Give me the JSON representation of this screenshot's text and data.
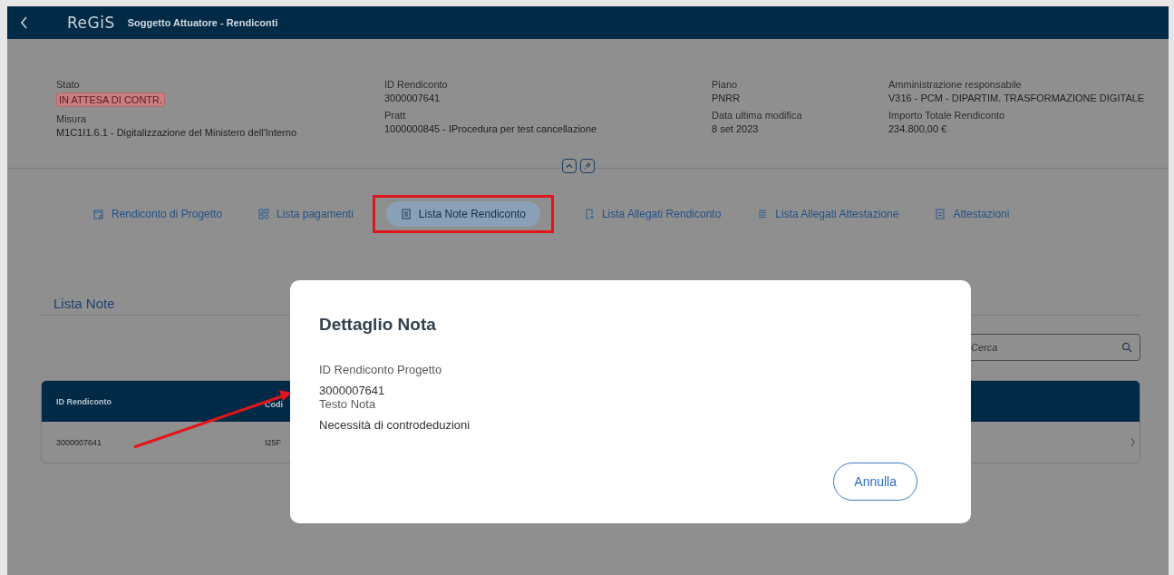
{
  "shell": {
    "logo": "ReGiS",
    "title": "Soggetto Attuatore - Rendiconti"
  },
  "info_columns": [
    {
      "fields": [
        {
          "label": "Stato",
          "value": "IN ATTESA DI CONTR.",
          "kind": "status"
        },
        {
          "label": "Misura",
          "value": "M1C1I1.6.1 - Digitalizzazione del Ministero dell'Interno",
          "kind": "text"
        }
      ]
    },
    {
      "fields": [
        {
          "label": "ID Rendiconto",
          "value": "3000007641",
          "kind": "text"
        },
        {
          "label": "Pratt",
          "value": "1000000845 - IProcedura per test cancellazione",
          "kind": "text"
        }
      ]
    },
    {
      "fields": [
        {
          "label": "Piano",
          "value": "PNRR",
          "kind": "text"
        },
        {
          "label": "Data ultima modifica",
          "value": "8 set 2023",
          "kind": "text"
        }
      ]
    },
    {
      "fields": [
        {
          "label": "Amministrazione responsabile",
          "value": "V316 - PCM - DIPARTIM. TRASFORMAZIONE DIGITALE",
          "kind": "text"
        },
        {
          "label": "Importo Totale Rendiconto",
          "value": "234.800,00 €",
          "kind": "text"
        }
      ]
    }
  ],
  "tabs": [
    {
      "label": "Rendiconto di Progetto",
      "selected": false,
      "outlined": false
    },
    {
      "label": "Lista pagamenti",
      "selected": false,
      "outlined": false
    },
    {
      "label": "Lista Note Rendiconto",
      "selected": true,
      "outlined": true
    },
    {
      "label": "Lista Allegati Rendiconto",
      "selected": false,
      "outlined": false
    },
    {
      "label": "Lista Allegati Attestazione",
      "selected": false,
      "outlined": false
    },
    {
      "label": "Attestazioni",
      "selected": false,
      "outlined": false
    }
  ],
  "section": {
    "title": "Lista Note",
    "search": {
      "placeholder": "Cerca"
    }
  },
  "table": {
    "columns": [
      "ID Rendiconto",
      "Codi"
    ],
    "rows": [
      {
        "cells": [
          "3000007641",
          "I25F"
        ]
      }
    ]
  },
  "dialog": {
    "title": "Dettaglio Nota",
    "fields": [
      {
        "label": "ID Rendiconto Progetto",
        "value": "3000007641"
      },
      {
        "label": "Testo Nota",
        "value": "Necessità di controdeduzioni"
      }
    ],
    "buttons": [
      "Annulla"
    ]
  }
}
